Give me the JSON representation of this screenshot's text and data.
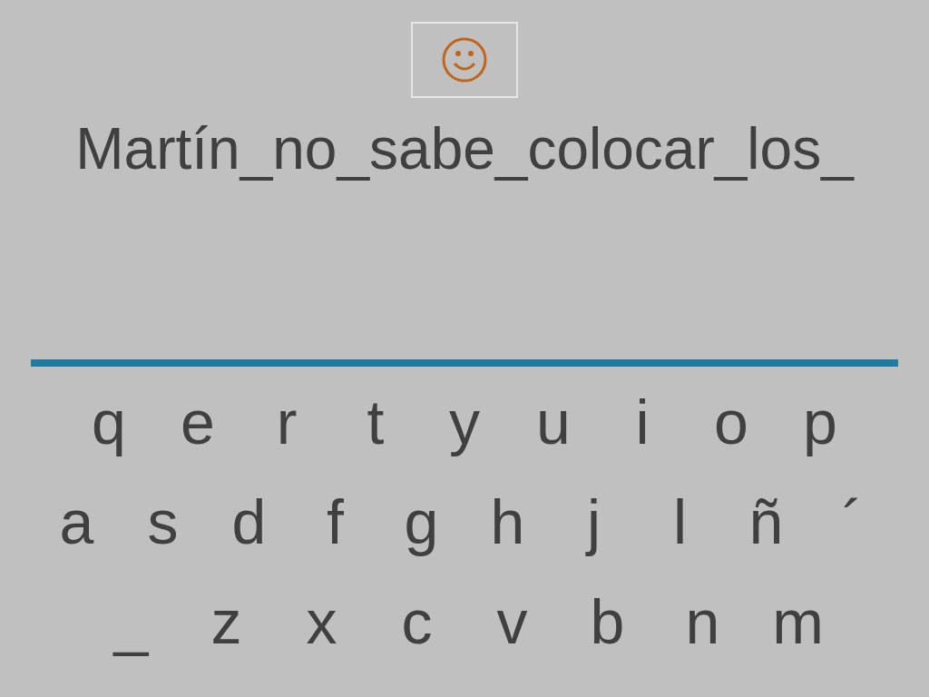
{
  "sentence": "Martín_no_sabe_colocar_los_",
  "keyboard": {
    "rows": [
      {
        "keys": [
          "q",
          "e",
          "r",
          "t",
          "y",
          "u",
          "i",
          "o",
          "p"
        ]
      },
      {
        "keys": [
          "a",
          "s",
          "d",
          "f",
          "g",
          "h",
          "j",
          "l",
          "ñ",
          "´"
        ]
      },
      {
        "keys": [
          "_",
          "z",
          "x",
          "c",
          "v",
          "b",
          "n",
          "m"
        ]
      }
    ]
  }
}
